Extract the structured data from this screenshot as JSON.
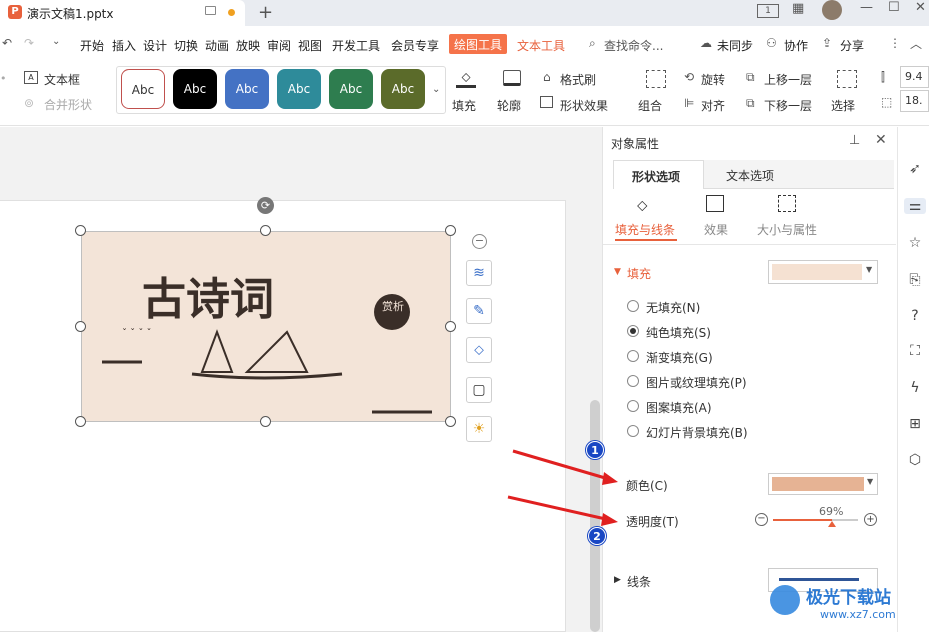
{
  "title_bar": {
    "doc_name": "演示文稿1.pptx"
  },
  "menu": {
    "items": [
      "开始",
      "插入",
      "设计",
      "切换",
      "动画",
      "放映",
      "审阅",
      "视图",
      "开发工具",
      "会员专享",
      "绘图工具",
      "文本工具"
    ],
    "search": "查找命令...",
    "sync": "未同步",
    "collab": "协作",
    "share": "分享"
  },
  "ribbon": {
    "textbox": "文本框",
    "merge_shape": "合并形状",
    "style_samples": [
      "Abc",
      "Abc",
      "Abc",
      "Abc",
      "Abc",
      "Abc"
    ],
    "style_colors": [
      "#ffffff",
      "#000000",
      "#4472c4",
      "#2e8b9a",
      "#2e7d4f",
      "#5b6b2a"
    ],
    "fill": "填充",
    "outline": "轮廓",
    "format_brush": "格式刷",
    "shape_effect": "形状效果",
    "combine": "组合",
    "rotate": "旋转",
    "align": "对齐",
    "up_layer": "上移一层",
    "down_layer": "下移一层",
    "select": "选择",
    "size_w": "9.4",
    "size_h": "18."
  },
  "canvas": {
    "image_title": "古诗词",
    "seal_text": "赏析"
  },
  "panel": {
    "title": "对象属性",
    "tab_shape": "形状选项",
    "tab_text": "文本选项",
    "sub_fill_line": "填充与线条",
    "sub_effect": "效果",
    "sub_size": "大小与属性",
    "fill_section": "填充",
    "options": [
      "无填充(N)",
      "纯色填充(S)",
      "渐变填充(G)",
      "图片或纹理填充(P)",
      "图案填充(A)",
      "幻灯片背景填充(B)"
    ],
    "color_label": "颜色(C)",
    "transparency_label": "透明度(T)",
    "transparency_value": "69%",
    "transparency_fraction": 0.69,
    "line_section": "线条",
    "fill_swatch_color": "#f5e1d2",
    "color_swatch_color": "#e6b394"
  },
  "badges": [
    "1",
    "2"
  ],
  "watermark": {
    "site": "极光下载站",
    "url": "www.xz7.com"
  },
  "accent_color": "#f5734a"
}
